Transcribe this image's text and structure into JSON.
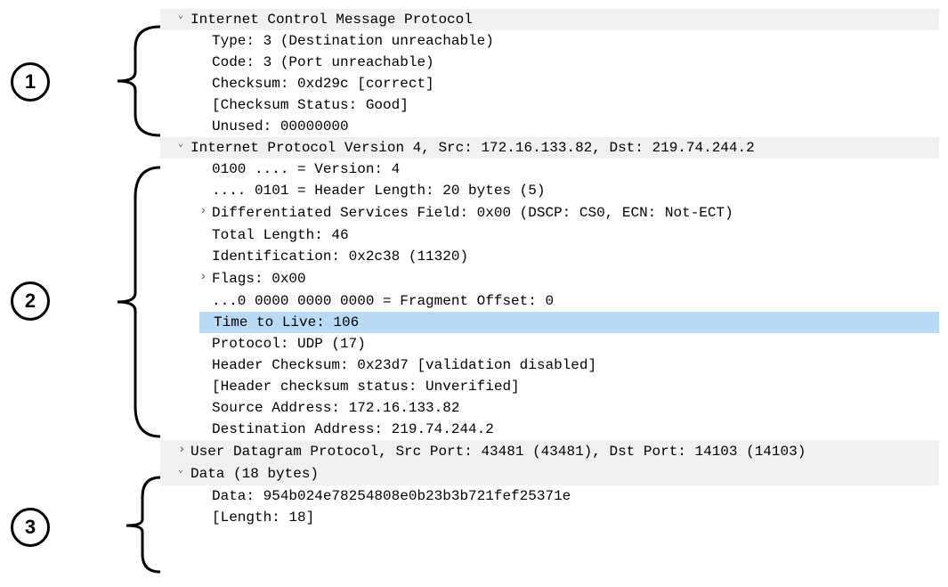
{
  "annotations": {
    "label1": "1",
    "label2": "2",
    "label3": "3"
  },
  "icmp": {
    "header": "Internet Control Message Protocol",
    "type": "Type: 3 (Destination unreachable)",
    "code": "Code: 3 (Port unreachable)",
    "checksum": "Checksum: 0xd29c [correct]",
    "checksum_status": "[Checksum Status: Good]",
    "unused": "Unused: 00000000"
  },
  "ipv4": {
    "header": "Internet Protocol Version 4, Src: 172.16.133.82, Dst: 219.74.244.2",
    "version": "0100 .... = Version: 4",
    "header_length": ".... 0101 = Header Length: 20 bytes (5)",
    "dsf": "Differentiated Services Field: 0x00 (DSCP: CS0, ECN: Not-ECT)",
    "total_length": "Total Length: 46",
    "identification": "Identification: 0x2c38 (11320)",
    "flags": "Flags: 0x00",
    "fragment_offset": "...0 0000 0000 0000 = Fragment Offset: 0",
    "ttl": "Time to Live: 106",
    "protocol": "Protocol: UDP (17)",
    "header_checksum": "Header Checksum: 0x23d7 [validation disabled]",
    "header_checksum_status": "[Header checksum status: Unverified]",
    "src_addr": "Source Address: 172.16.133.82",
    "dst_addr": "Destination Address: 219.74.244.2"
  },
  "udp": {
    "header": "User Datagram Protocol, Src Port: 43481 (43481), Dst Port: 14103 (14103)"
  },
  "data": {
    "header": "Data (18 bytes)",
    "data": "Data: 954b024e78254808e0b23b3b721fef25371e",
    "length": "[Length: 18]"
  }
}
